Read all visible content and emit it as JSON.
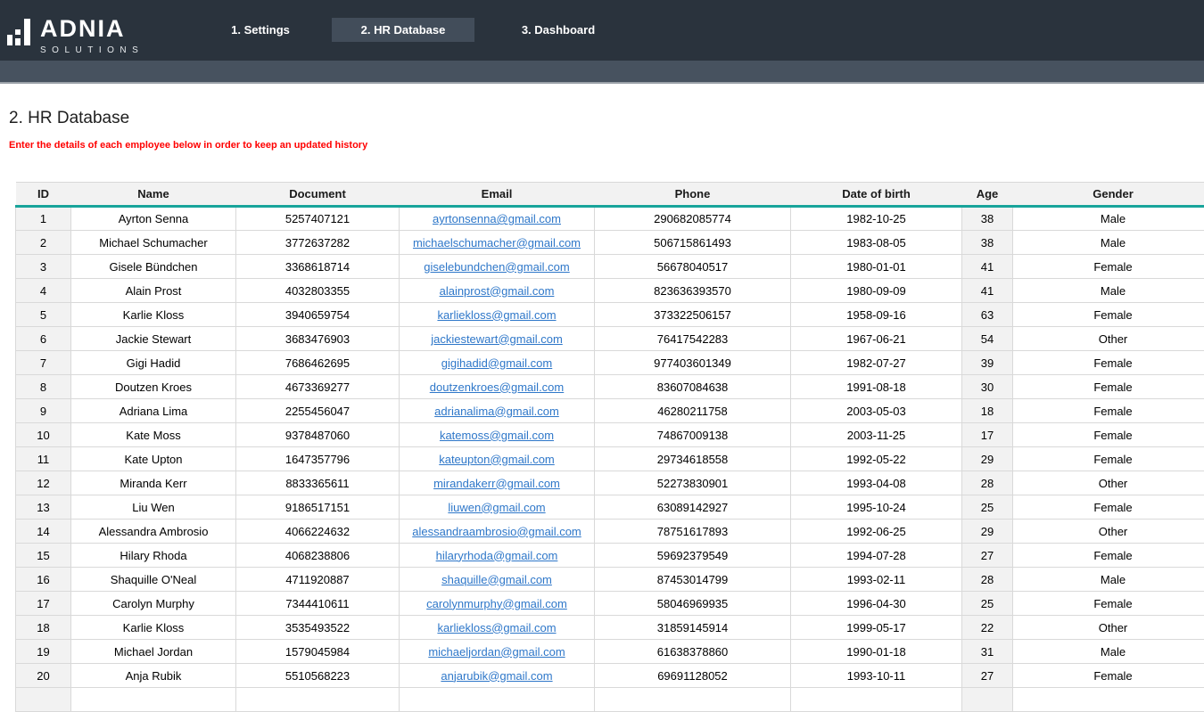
{
  "brand": {
    "name": "ADNIA",
    "tagline": "SOLUTIONS"
  },
  "nav": {
    "tabs": [
      {
        "label": "1. Settings",
        "active": false
      },
      {
        "label": "2. HR Database",
        "active": true
      },
      {
        "label": "3. Dashboard",
        "active": false
      }
    ]
  },
  "page": {
    "title": "2. HR Database",
    "note": "Enter the details of each employee below in order to keep an updated history"
  },
  "colors": {
    "topbar": "#2a333d",
    "subbar": "#47525f",
    "active_tab": "#424d5a",
    "teal_rule": "#18a49b",
    "note_red": "#ff0000",
    "link_blue": "#2e77c9",
    "header_gray": "#f2f2f2"
  },
  "table": {
    "columns": [
      "ID",
      "Name",
      "Document",
      "Email",
      "Phone",
      "Date of birth",
      "Age",
      "Gender"
    ],
    "rows": [
      {
        "id": "1",
        "name": "Ayrton Senna",
        "document": "5257407121",
        "email": "ayrtonsenna@gmail.com",
        "phone": "290682085774",
        "dob": "1982-10-25",
        "age": "38",
        "gender": "Male"
      },
      {
        "id": "2",
        "name": "Michael Schumacher",
        "document": "3772637282",
        "email": "michaelschumacher@gmail.com",
        "phone": "506715861493",
        "dob": "1983-08-05",
        "age": "38",
        "gender": "Male"
      },
      {
        "id": "3",
        "name": "Gisele Bündchen",
        "document": "3368618714",
        "email": "giselebundchen@gmail.com",
        "phone": "56678040517",
        "dob": "1980-01-01",
        "age": "41",
        "gender": "Female"
      },
      {
        "id": "4",
        "name": "Alain Prost",
        "document": "4032803355",
        "email": "alainprost@gmail.com",
        "phone": "823636393570",
        "dob": "1980-09-09",
        "age": "41",
        "gender": "Male"
      },
      {
        "id": "5",
        "name": "Karlie Kloss",
        "document": "3940659754",
        "email": "karliekloss@gmail.com",
        "phone": "373322506157",
        "dob": "1958-09-16",
        "age": "63",
        "gender": "Female"
      },
      {
        "id": "6",
        "name": "Jackie Stewart",
        "document": "3683476903",
        "email": "jackiestewart@gmail.com",
        "phone": "76417542283",
        "dob": "1967-06-21",
        "age": "54",
        "gender": "Other"
      },
      {
        "id": "7",
        "name": "Gigi Hadid",
        "document": "7686462695",
        "email": "gigihadid@gmail.com",
        "phone": "977403601349",
        "dob": "1982-07-27",
        "age": "39",
        "gender": "Female"
      },
      {
        "id": "8",
        "name": "Doutzen Kroes",
        "document": "4673369277",
        "email": "doutzenkroes@gmail.com",
        "phone": "83607084638",
        "dob": "1991-08-18",
        "age": "30",
        "gender": "Female"
      },
      {
        "id": "9",
        "name": "Adriana Lima",
        "document": "2255456047",
        "email": "adrianalima@gmail.com",
        "phone": "46280211758",
        "dob": "2003-05-03",
        "age": "18",
        "gender": "Female"
      },
      {
        "id": "10",
        "name": "Kate Moss",
        "document": "9378487060",
        "email": "katemoss@gmail.com",
        "phone": "74867009138",
        "dob": "2003-11-25",
        "age": "17",
        "gender": "Female"
      },
      {
        "id": "11",
        "name": "Kate Upton",
        "document": "1647357796",
        "email": "kateupton@gmail.com",
        "phone": "29734618558",
        "dob": "1992-05-22",
        "age": "29",
        "gender": "Female"
      },
      {
        "id": "12",
        "name": "Miranda Kerr",
        "document": "8833365611",
        "email": "mirandakerr@gmail.com",
        "phone": "52273830901",
        "dob": "1993-04-08",
        "age": "28",
        "gender": "Other"
      },
      {
        "id": "13",
        "name": "Liu Wen",
        "document": "9186517151",
        "email": "liuwen@gmail.com",
        "phone": "63089142927",
        "dob": "1995-10-24",
        "age": "25",
        "gender": "Female"
      },
      {
        "id": "14",
        "name": "Alessandra Ambrosio",
        "document": "4066224632",
        "email": "alessandraambrosio@gmail.com",
        "phone": "78751617893",
        "dob": "1992-06-25",
        "age": "29",
        "gender": "Other"
      },
      {
        "id": "15",
        "name": "Hilary Rhoda",
        "document": "4068238806",
        "email": "hilaryrhoda@gmail.com",
        "phone": "59692379549",
        "dob": "1994-07-28",
        "age": "27",
        "gender": "Female"
      },
      {
        "id": "16",
        "name": "Shaquille O'Neal",
        "document": "4711920887",
        "email": "shaquille@gmail.com",
        "phone": "87453014799",
        "dob": "1993-02-11",
        "age": "28",
        "gender": "Male"
      },
      {
        "id": "17",
        "name": "Carolyn Murphy",
        "document": "7344410611",
        "email": "carolynmurphy@gmail.com",
        "phone": "58046969935",
        "dob": "1996-04-30",
        "age": "25",
        "gender": "Female"
      },
      {
        "id": "18",
        "name": "Karlie Kloss",
        "document": "3535493522",
        "email": "karliekloss@gmail.com",
        "phone": "31859145914",
        "dob": "1999-05-17",
        "age": "22",
        "gender": "Other"
      },
      {
        "id": "19",
        "name": "Michael Jordan",
        "document": "1579045984",
        "email": "michaeljordan@gmail.com",
        "phone": "61638378860",
        "dob": "1990-01-18",
        "age": "31",
        "gender": "Male"
      },
      {
        "id": "20",
        "name": "Anja Rubik",
        "document": "5510568223",
        "email": "anjarubik@gmail.com",
        "phone": "69691128052",
        "dob": "1993-10-11",
        "age": "27",
        "gender": "Female"
      }
    ]
  }
}
